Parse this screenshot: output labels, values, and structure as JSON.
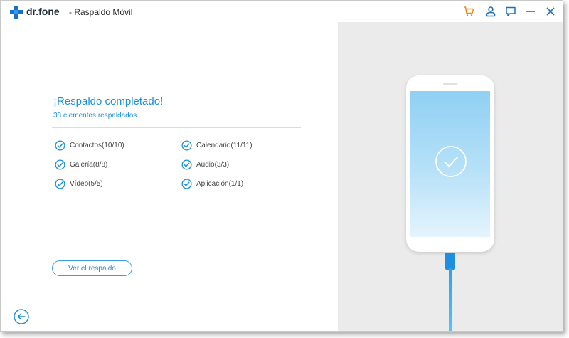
{
  "titlebar": {
    "brand": "dr.fone",
    "title": "- Raspaldo Móvil",
    "icons": [
      "cart-icon",
      "user-icon",
      "feedback-icon",
      "minimize-icon",
      "close-icon"
    ]
  },
  "summary": {
    "heading": "¡Respaldo completado!",
    "subheading": "38 elementos respaldados",
    "items": [
      {
        "label": "Contactos(10/10)"
      },
      {
        "label": "Calendario(11/11)"
      },
      {
        "label": "Galería(8/8)"
      },
      {
        "label": "Audio(3/3)"
      },
      {
        "label": "Vídeo(5/5)"
      },
      {
        "label": "Aplicación(1/1)"
      }
    ]
  },
  "actions": {
    "view_backup": "Ver el respaldo"
  },
  "colors": {
    "accent": "#1c8fd8",
    "cart": "#f08a1c",
    "panel": "#ebebeb"
  }
}
